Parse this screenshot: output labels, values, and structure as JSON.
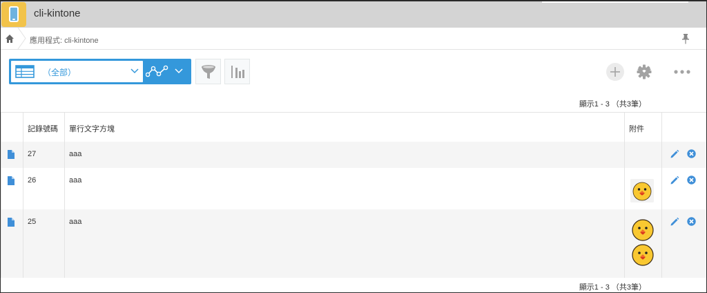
{
  "app": {
    "title": "cli-kintone",
    "icon": "mobile-phone-icon",
    "icon_color": "#f2c34a"
  },
  "breadcrumb": {
    "home_icon": "home-icon",
    "label": "應用程式: cli-kintone",
    "pin_icon": "pin-icon"
  },
  "toolbar": {
    "view_select": {
      "label": "（全部）",
      "icon": "table-icon",
      "accent": "#3498db"
    },
    "graph_menu_icon": "line-graph-icon",
    "filter_icon": "filter-icon",
    "graph_icon": "bar-chart-icon",
    "add_icon": "plus-icon",
    "settings_icon": "gear-icon",
    "more_icon": "more-icon"
  },
  "pager": {
    "top": "顯示1 - 3 （共3筆）",
    "bottom": "顯示1 - 3 （共3筆）"
  },
  "table": {
    "columns": [
      "",
      "記錄號碼",
      "單行文字方塊",
      "附件",
      ""
    ],
    "rows": [
      {
        "record_no": "27",
        "text": "aaa",
        "attachments": 0
      },
      {
        "record_no": "26",
        "text": "aaa",
        "attachments": 1
      },
      {
        "record_no": "25",
        "text": "aaa",
        "attachments": 2
      }
    ]
  }
}
